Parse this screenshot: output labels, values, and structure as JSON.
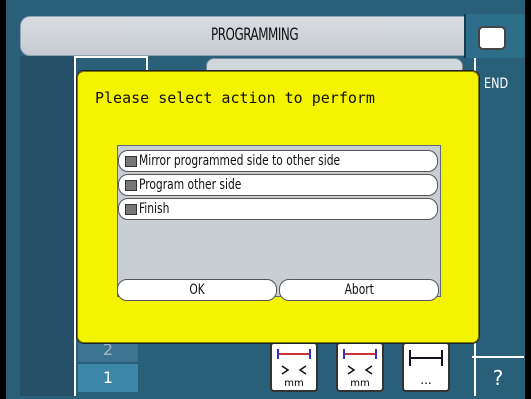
{
  "header": {
    "title": "PROGRAMMING"
  },
  "side": {
    "end_label": "END",
    "help_label": "?"
  },
  "tabs": {
    "two": "2",
    "one": "1"
  },
  "dialog": {
    "prompt": "Please select action to perform",
    "options": [
      "Mirror programmed side to other side",
      "Program other side",
      "Finish"
    ],
    "ok": "OK",
    "abort": "Abort"
  },
  "toolbar": {
    "tool1": "mm",
    "tool2": "mm",
    "tool3": "..."
  },
  "colors": {
    "dialog_bg": "#f4f400",
    "screen_bg": "#2a5f79"
  }
}
